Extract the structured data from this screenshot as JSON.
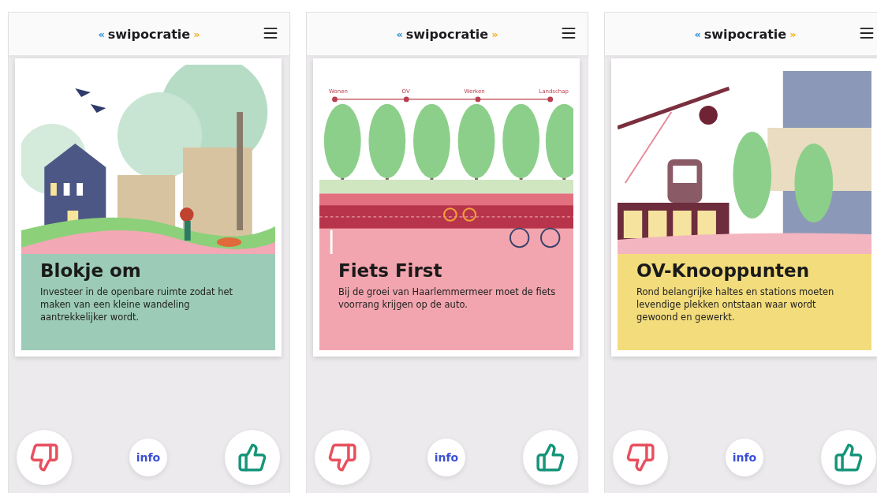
{
  "screens": [
    {
      "logo": {
        "open": "«",
        "name": "swipocratie",
        "close": "»"
      },
      "card": {
        "kind": "park",
        "color": "#9ccbb7",
        "title": "Blokje om",
        "description": "Investeer in de openbare ruimte zodat het maken van een kleine wandeling aantrekkelijker wordt."
      },
      "info": "info"
    },
    {
      "logo": {
        "open": "«",
        "name": "swipocratie",
        "close": "»"
      },
      "card": {
        "kind": "cycling",
        "color": "#f2a5ae",
        "route_stops": [
          "Wonen",
          "OV",
          "Werken",
          "Landschap"
        ],
        "title": "Fiets First",
        "description": "Bij de groei van Haarlemmermeer moet de fiets voorrang krijgen op de auto."
      },
      "info": "info"
    },
    {
      "logo": {
        "open": "«",
        "name": "swipocratie",
        "close": "»"
      },
      "card": {
        "kind": "station",
        "color": "#f3dc7c",
        "title": "OV-Knooppunten",
        "description": "Rond belangrijke haltes en stations moeten levendige plekken ontstaan waar wordt gewoond en gewerkt."
      },
      "info": "info"
    }
  ]
}
